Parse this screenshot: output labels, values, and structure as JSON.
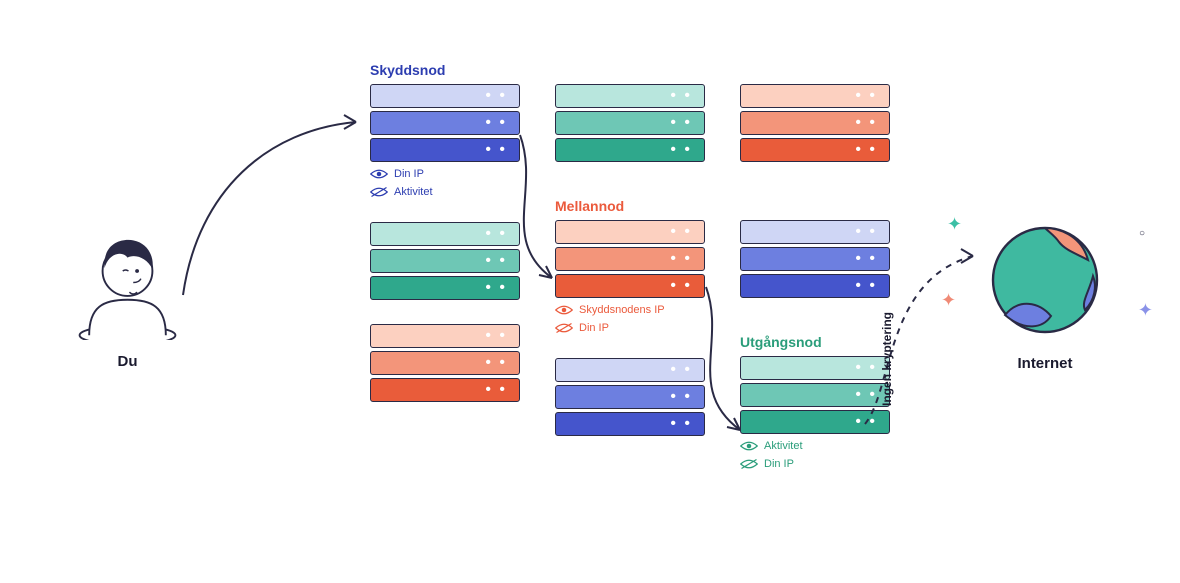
{
  "user": {
    "label": "Du"
  },
  "internet": {
    "label": "Internet"
  },
  "noEncryptionLabel": "Ingen kryptering",
  "nodes": {
    "guard": {
      "title": "Skyddsnod",
      "visible": "Din IP",
      "hidden": "Aktivitet"
    },
    "middle": {
      "title": "Mellannod",
      "visible": "Skyddsnodens IP",
      "hidden": "Din IP"
    },
    "exit": {
      "title": "Utgångsnod",
      "visible": "Aktivitet",
      "hidden": "Din IP"
    }
  }
}
